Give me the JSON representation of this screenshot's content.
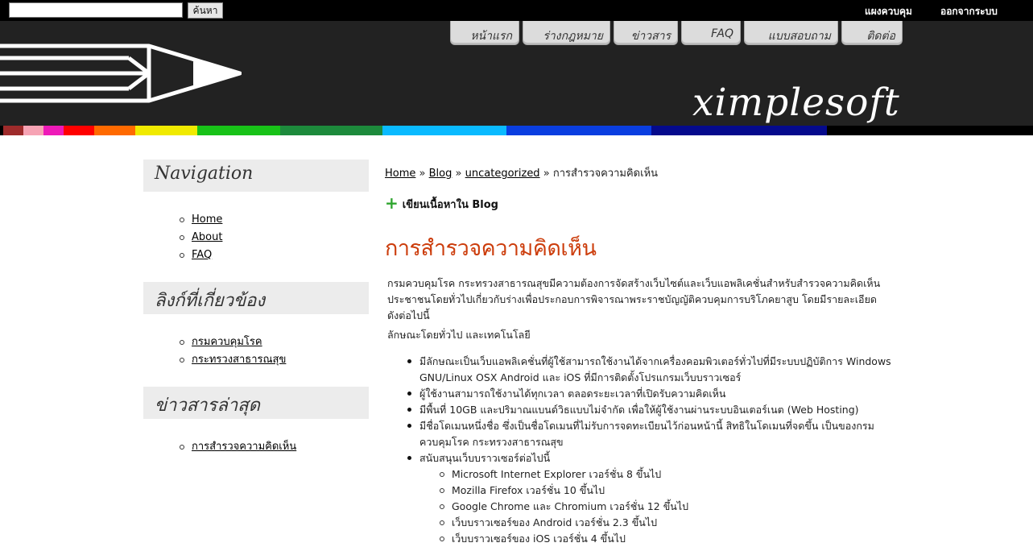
{
  "topbar": {
    "search_placeholder": "",
    "search_button": "ค้นหา",
    "dashboard": "แผงควบคุม",
    "logout": "ออกจากระบบ"
  },
  "header": {
    "brand": "ximplesoft",
    "nav": [
      "หน้าแรก",
      "ร่างกฎหมาย",
      "ข่าวสาร",
      "FAQ",
      "แบบสอบถาม",
      "ติดต่อ"
    ]
  },
  "colors": {
    "stripes": [
      "#9e2b2b",
      "#f6a3b4",
      "#ee1ab8",
      "#ff0000",
      "#ff6a00",
      "#f0ea00",
      "#18c218",
      "#1d8a3c",
      "#0abaff",
      "#0a3ee0",
      "#050a8c"
    ],
    "title": "#cc3d0c"
  },
  "sidebar": {
    "nav_title": "Navigation",
    "nav_items": [
      "Home",
      "About",
      "FAQ"
    ],
    "links_title": "ลิงก์ที่เกี่ยวข้อง",
    "links_items": [
      "กรมควบคุมโรค",
      "กระทรวงสาธารณสุข"
    ],
    "news_title": "ข่าวสารล่าสุด",
    "news_items": [
      "การสำรวจความคิดเห็น"
    ]
  },
  "content": {
    "breadcrumb": [
      "Home",
      "Blog",
      "uncategorized",
      "การสำรวจความคิดเห็น"
    ],
    "write_link": "เขียนเนื้อหาใน Blog",
    "title": "การสำรวจความคิดเห็น",
    "intro": "กรมควบคุมโรค กระทรวงสาธารณสุขมีความต้องการจัดสร้างเว็บไซต์และเว็บแอพลิเคชั่นสำหรับสำรวจความคิดเห็นประชาชนโดยทั่วไปเกี่ยวกับร่างเพื่อประกอบการพิจารณาพระราชบัญญัติควบคุมการบริโภคยาสูบ โดยมีรายละเอียดดังต่อไปนี้",
    "subheading": "ลักษณะโดยทั่วไป และเทคโนโลยี",
    "bullets": [
      "มีลักษณะเป็นเว็บแอพลิเคชั่นที่ผู้ใช้สามารถใช้งานได้จากเครื่องคอมพิวเตอร์ทั่วไปที่มีระบบปฏิบัติการ Windows GNU/Linux OSX Android และ iOS ที่มีการติดตั้งโปรแกรมเว็บบราวเซอร์",
      "ผู้ใช้งานสามารถใช้งานได้ทุกเวลา ตลอดระยะเวลาที่เปิดรับความคิดเห็น",
      "มีพื้นที่ 10GB และปริมาณแบนด์วิธแบบไม่จำกัด เพื่อให้ผู้ใช้งานผ่านระบบอินเตอร์เนต (Web Hosting)",
      "มีชื่อโดเมนหนึ่งชื่อ ซึ่งเป็นชื่อโดเมนที่ไม่รับการจดทะเบียนไว้ก่อนหน้านี้ สิทธิในโดเมนที่จดขึ้น เป็นของกรมควบคุมโรค กระทรวงสาธารณสุข",
      "สนับสนุนเว็บบราวเซอร์ต่อไปนี้"
    ],
    "browsers": [
      "Microsoft Internet Explorer เวอร์ชั่น 8 ขึ้นไป",
      "Mozilla Firefox เวอร์ชั่น 10 ขึ้นไป",
      "Google Chrome และ Chromium เวอร์ชั่น 12 ขึ้นไป",
      "เว็บบราวเซอร์ของ Android เวอร์ชั่น 2.3 ขึ้นไป",
      "เว็บบราวเซอร์ของ iOS เวอร์ชั่น 4 ขึ้นไป"
    ]
  }
}
